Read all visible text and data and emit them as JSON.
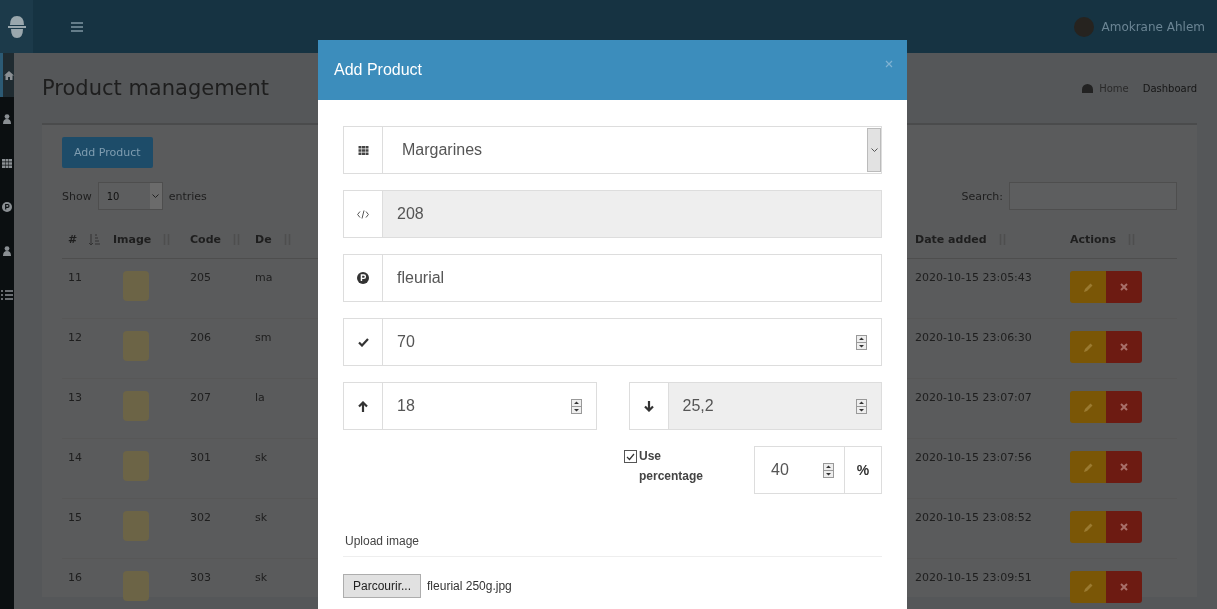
{
  "topbar": {
    "user_name": "Amokrane Ahlem"
  },
  "sidebar": {
    "items": [
      {
        "selected": true
      },
      {
        "selected": false
      },
      {
        "selected": false
      },
      {
        "selected": false
      },
      {
        "selected": false
      },
      {
        "selected": false
      }
    ]
  },
  "page": {
    "title": "Product management",
    "breadcrumb": [
      "Home",
      "Dashboard"
    ],
    "add_button": "Add Product",
    "length_menu": {
      "before": "Show",
      "value": "10",
      "after": "entries"
    },
    "search_label": "Search:",
    "table": {
      "columns": [
        {
          "label": "#",
          "sorted": true
        },
        {
          "label": "Image",
          "sorted": false
        },
        {
          "label": "Code",
          "sorted": false
        },
        {
          "label": "De",
          "sorted": false
        },
        {
          "sorted": false
        },
        {
          "label": "Date added",
          "sorted": false
        },
        {
          "label": "Actions",
          "sorted": false
        }
      ],
      "rows": [
        {
          "number": "11",
          "code": "205",
          "description": "ma",
          "date": "2020-10-15 23:05:43"
        },
        {
          "number": "12",
          "code": "206",
          "description": "sm",
          "date": "2020-10-15 23:06:30"
        },
        {
          "number": "13",
          "code": "207",
          "description": "la",
          "date": "2020-10-15 23:07:07"
        },
        {
          "number": "14",
          "code": "301",
          "description": "sk",
          "date": "2020-10-15 23:07:56"
        },
        {
          "number": "15",
          "code": "302",
          "description": "sk",
          "date": "2020-10-15 23:08:52"
        },
        {
          "number": "16",
          "code": "303",
          "description": "sk",
          "date": "2020-10-15 23:09:51"
        }
      ]
    }
  },
  "modal": {
    "title": "Add Product",
    "field_rows": [
      [
        {
          "kind": "select",
          "value": "Margarines",
          "disabled": false
        }
      ],
      [
        {
          "kind": "text",
          "value": "208",
          "disabled": true
        }
      ],
      [
        {
          "kind": "text",
          "value": "fleurial",
          "disabled": false
        }
      ],
      [
        {
          "kind": "number",
          "value": "70",
          "disabled": false
        }
      ],
      [
        {
          "kind": "number",
          "value": "18",
          "disabled": false
        },
        {
          "kind": "number",
          "value": "25,2",
          "disabled": true
        }
      ]
    ],
    "percentage": {
      "label": "Use percentage",
      "checked": true,
      "value": "40",
      "unit": "%"
    },
    "upload": {
      "label": "Upload image",
      "button": "Parcourir...",
      "filename": "fleurial 250g.jpg"
    }
  }
}
